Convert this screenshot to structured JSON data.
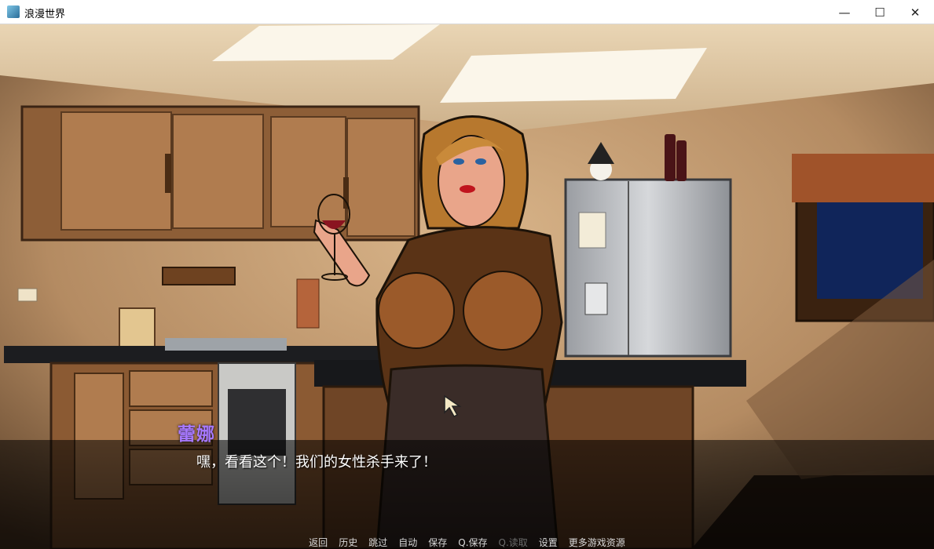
{
  "window": {
    "title": "浪漫世界",
    "minimize_glyph": "—",
    "maximize_glyph": "☐",
    "close_glyph": "✕"
  },
  "dialogue": {
    "speaker": "蕾娜",
    "text": "嘿，看看这个！我们的女性杀手来了！",
    "speaker_color": "#a779ff"
  },
  "quick_menu": {
    "back": "返回",
    "history": "历史",
    "skip": "跳过",
    "auto": "自动",
    "save": "保存",
    "quick_save": "Q.保存",
    "quick_load": "Q.读取",
    "settings": "设置",
    "more": "更多游戏资源"
  }
}
